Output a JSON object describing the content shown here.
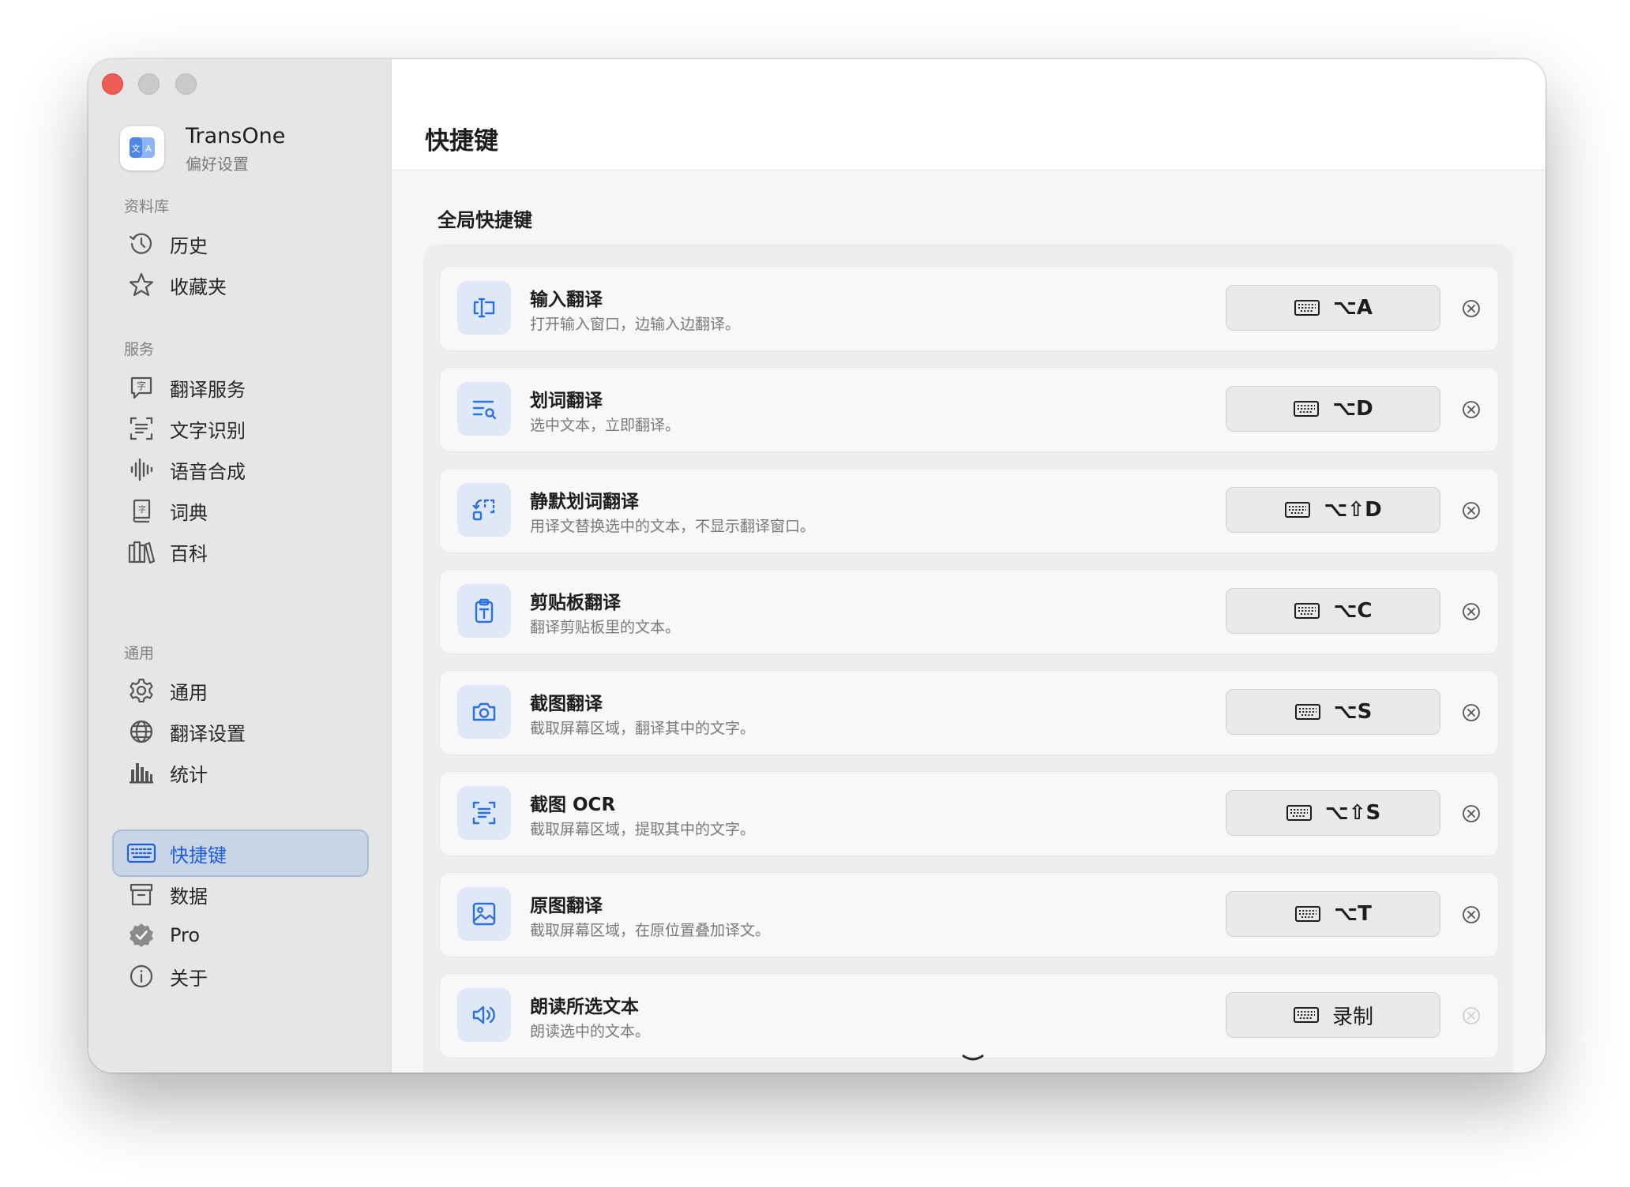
{
  "app": {
    "name": "TransOne",
    "subtitle": "偏好设置"
  },
  "sidebar": {
    "sections": [
      {
        "label": "资料库",
        "items": [
          {
            "label": "历史",
            "icon": "history-icon"
          },
          {
            "label": "收藏夹",
            "icon": "star-icon"
          }
        ]
      },
      {
        "label": "服务",
        "items": [
          {
            "label": "翻译服务",
            "icon": "translate-bubble-icon"
          },
          {
            "label": "文字识别",
            "icon": "text-viewfinder-icon"
          },
          {
            "label": "语音合成",
            "icon": "waveform-icon"
          },
          {
            "label": "词典",
            "icon": "dictionary-book-icon"
          },
          {
            "label": "百科",
            "icon": "books-icon"
          }
        ]
      },
      {
        "label": "通用",
        "items": [
          {
            "label": "通用",
            "icon": "gear-icon"
          },
          {
            "label": "翻译设置",
            "icon": "globe-icon"
          },
          {
            "label": "统计",
            "icon": "bar-chart-icon"
          },
          {
            "label": "快捷键",
            "icon": "keyboard-icon",
            "active": true
          },
          {
            "label": "数据",
            "icon": "archive-box-icon"
          },
          {
            "label": "Pro",
            "icon": "checkmark-seal-icon"
          },
          {
            "label": "关于",
            "icon": "info-circle-icon"
          }
        ]
      }
    ]
  },
  "main": {
    "title": "快捷键",
    "group_title": "全局快捷键",
    "shortcuts": [
      {
        "title": "输入翻译",
        "desc": "打开输入窗口，边输入边翻译。",
        "keys": "⌥A",
        "icon": "text-cursor-icon"
      },
      {
        "title": "划词翻译",
        "desc": "选中文本，立即翻译。",
        "keys": "⌥D",
        "icon": "text-magnify-icon"
      },
      {
        "title": "静默划词翻译",
        "desc": "用译文替换选中的文本，不显示翻译窗口。",
        "keys": "⌥⇧D",
        "icon": "replace-selection-icon"
      },
      {
        "title": "剪贴板翻译",
        "desc": "翻译剪贴板里的文本。",
        "keys": "⌥C",
        "icon": "clipboard-text-icon"
      },
      {
        "title": "截图翻译",
        "desc": "截取屏幕区域，翻译其中的文字。",
        "keys": "⌥S",
        "icon": "camera-icon"
      },
      {
        "title": "截图 OCR",
        "desc": "截取屏幕区域，提取其中的文字。",
        "keys": "⌥⇧S",
        "icon": "text-viewfinder-icon"
      },
      {
        "title": "原图翻译",
        "desc": "截取屏幕区域，在原位置叠加译文。",
        "keys": "⌥T",
        "icon": "photo-icon"
      },
      {
        "title": "朗读所选文本",
        "desc": "朗读选中的文本。",
        "keys": "录制",
        "icon": "speaker-wave-icon"
      }
    ]
  },
  "colors": {
    "accent": "#1f5fdc",
    "active_bg": "#c9d4e7",
    "icon_tile": "#dfe8f7",
    "close_light": "#ee5c56"
  }
}
